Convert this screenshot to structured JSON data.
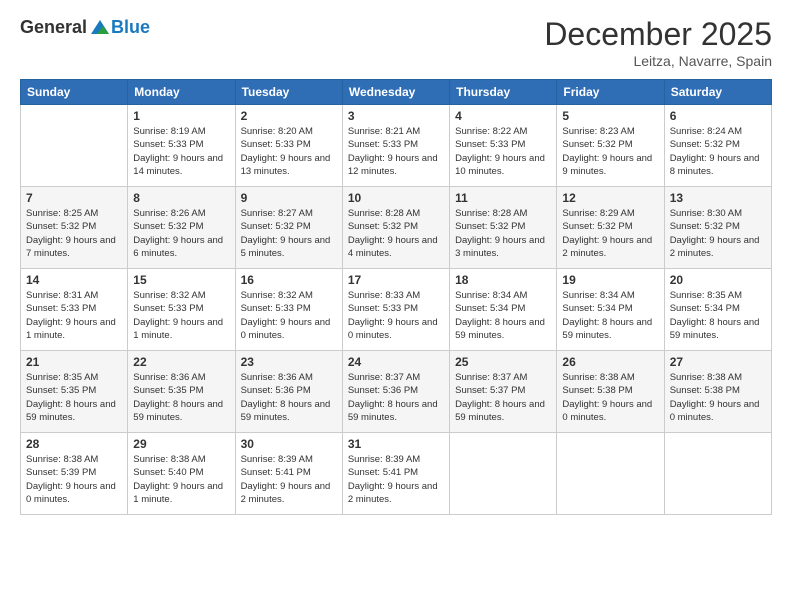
{
  "logo": {
    "text_general": "General",
    "text_blue": "Blue"
  },
  "title": {
    "month_year": "December 2025",
    "location": "Leitza, Navarre, Spain"
  },
  "weekdays": [
    "Sunday",
    "Monday",
    "Tuesday",
    "Wednesday",
    "Thursday",
    "Friday",
    "Saturday"
  ],
  "weeks": [
    [
      {
        "day": "",
        "sunrise": "",
        "sunset": "",
        "daylight": ""
      },
      {
        "day": "1",
        "sunrise": "Sunrise: 8:19 AM",
        "sunset": "Sunset: 5:33 PM",
        "daylight": "Daylight: 9 hours and 14 minutes."
      },
      {
        "day": "2",
        "sunrise": "Sunrise: 8:20 AM",
        "sunset": "Sunset: 5:33 PM",
        "daylight": "Daylight: 9 hours and 13 minutes."
      },
      {
        "day": "3",
        "sunrise": "Sunrise: 8:21 AM",
        "sunset": "Sunset: 5:33 PM",
        "daylight": "Daylight: 9 hours and 12 minutes."
      },
      {
        "day": "4",
        "sunrise": "Sunrise: 8:22 AM",
        "sunset": "Sunset: 5:33 PM",
        "daylight": "Daylight: 9 hours and 10 minutes."
      },
      {
        "day": "5",
        "sunrise": "Sunrise: 8:23 AM",
        "sunset": "Sunset: 5:32 PM",
        "daylight": "Daylight: 9 hours and 9 minutes."
      },
      {
        "day": "6",
        "sunrise": "Sunrise: 8:24 AM",
        "sunset": "Sunset: 5:32 PM",
        "daylight": "Daylight: 9 hours and 8 minutes."
      }
    ],
    [
      {
        "day": "7",
        "sunrise": "Sunrise: 8:25 AM",
        "sunset": "Sunset: 5:32 PM",
        "daylight": "Daylight: 9 hours and 7 minutes."
      },
      {
        "day": "8",
        "sunrise": "Sunrise: 8:26 AM",
        "sunset": "Sunset: 5:32 PM",
        "daylight": "Daylight: 9 hours and 6 minutes."
      },
      {
        "day": "9",
        "sunrise": "Sunrise: 8:27 AM",
        "sunset": "Sunset: 5:32 PM",
        "daylight": "Daylight: 9 hours and 5 minutes."
      },
      {
        "day": "10",
        "sunrise": "Sunrise: 8:28 AM",
        "sunset": "Sunset: 5:32 PM",
        "daylight": "Daylight: 9 hours and 4 minutes."
      },
      {
        "day": "11",
        "sunrise": "Sunrise: 8:28 AM",
        "sunset": "Sunset: 5:32 PM",
        "daylight": "Daylight: 9 hours and 3 minutes."
      },
      {
        "day": "12",
        "sunrise": "Sunrise: 8:29 AM",
        "sunset": "Sunset: 5:32 PM",
        "daylight": "Daylight: 9 hours and 2 minutes."
      },
      {
        "day": "13",
        "sunrise": "Sunrise: 8:30 AM",
        "sunset": "Sunset: 5:32 PM",
        "daylight": "Daylight: 9 hours and 2 minutes."
      }
    ],
    [
      {
        "day": "14",
        "sunrise": "Sunrise: 8:31 AM",
        "sunset": "Sunset: 5:33 PM",
        "daylight": "Daylight: 9 hours and 1 minute."
      },
      {
        "day": "15",
        "sunrise": "Sunrise: 8:32 AM",
        "sunset": "Sunset: 5:33 PM",
        "daylight": "Daylight: 9 hours and 1 minute."
      },
      {
        "day": "16",
        "sunrise": "Sunrise: 8:32 AM",
        "sunset": "Sunset: 5:33 PM",
        "daylight": "Daylight: 9 hours and 0 minutes."
      },
      {
        "day": "17",
        "sunrise": "Sunrise: 8:33 AM",
        "sunset": "Sunset: 5:33 PM",
        "daylight": "Daylight: 9 hours and 0 minutes."
      },
      {
        "day": "18",
        "sunrise": "Sunrise: 8:34 AM",
        "sunset": "Sunset: 5:34 PM",
        "daylight": "Daylight: 8 hours and 59 minutes."
      },
      {
        "day": "19",
        "sunrise": "Sunrise: 8:34 AM",
        "sunset": "Sunset: 5:34 PM",
        "daylight": "Daylight: 8 hours and 59 minutes."
      },
      {
        "day": "20",
        "sunrise": "Sunrise: 8:35 AM",
        "sunset": "Sunset: 5:34 PM",
        "daylight": "Daylight: 8 hours and 59 minutes."
      }
    ],
    [
      {
        "day": "21",
        "sunrise": "Sunrise: 8:35 AM",
        "sunset": "Sunset: 5:35 PM",
        "daylight": "Daylight: 8 hours and 59 minutes."
      },
      {
        "day": "22",
        "sunrise": "Sunrise: 8:36 AM",
        "sunset": "Sunset: 5:35 PM",
        "daylight": "Daylight: 8 hours and 59 minutes."
      },
      {
        "day": "23",
        "sunrise": "Sunrise: 8:36 AM",
        "sunset": "Sunset: 5:36 PM",
        "daylight": "Daylight: 8 hours and 59 minutes."
      },
      {
        "day": "24",
        "sunrise": "Sunrise: 8:37 AM",
        "sunset": "Sunset: 5:36 PM",
        "daylight": "Daylight: 8 hours and 59 minutes."
      },
      {
        "day": "25",
        "sunrise": "Sunrise: 8:37 AM",
        "sunset": "Sunset: 5:37 PM",
        "daylight": "Daylight: 8 hours and 59 minutes."
      },
      {
        "day": "26",
        "sunrise": "Sunrise: 8:38 AM",
        "sunset": "Sunset: 5:38 PM",
        "daylight": "Daylight: 9 hours and 0 minutes."
      },
      {
        "day": "27",
        "sunrise": "Sunrise: 8:38 AM",
        "sunset": "Sunset: 5:38 PM",
        "daylight": "Daylight: 9 hours and 0 minutes."
      }
    ],
    [
      {
        "day": "28",
        "sunrise": "Sunrise: 8:38 AM",
        "sunset": "Sunset: 5:39 PM",
        "daylight": "Daylight: 9 hours and 0 minutes."
      },
      {
        "day": "29",
        "sunrise": "Sunrise: 8:38 AM",
        "sunset": "Sunset: 5:40 PM",
        "daylight": "Daylight: 9 hours and 1 minute."
      },
      {
        "day": "30",
        "sunrise": "Sunrise: 8:39 AM",
        "sunset": "Sunset: 5:41 PM",
        "daylight": "Daylight: 9 hours and 2 minutes."
      },
      {
        "day": "31",
        "sunrise": "Sunrise: 8:39 AM",
        "sunset": "Sunset: 5:41 PM",
        "daylight": "Daylight: 9 hours and 2 minutes."
      },
      {
        "day": "",
        "sunrise": "",
        "sunset": "",
        "daylight": ""
      },
      {
        "day": "",
        "sunrise": "",
        "sunset": "",
        "daylight": ""
      },
      {
        "day": "",
        "sunrise": "",
        "sunset": "",
        "daylight": ""
      }
    ]
  ]
}
